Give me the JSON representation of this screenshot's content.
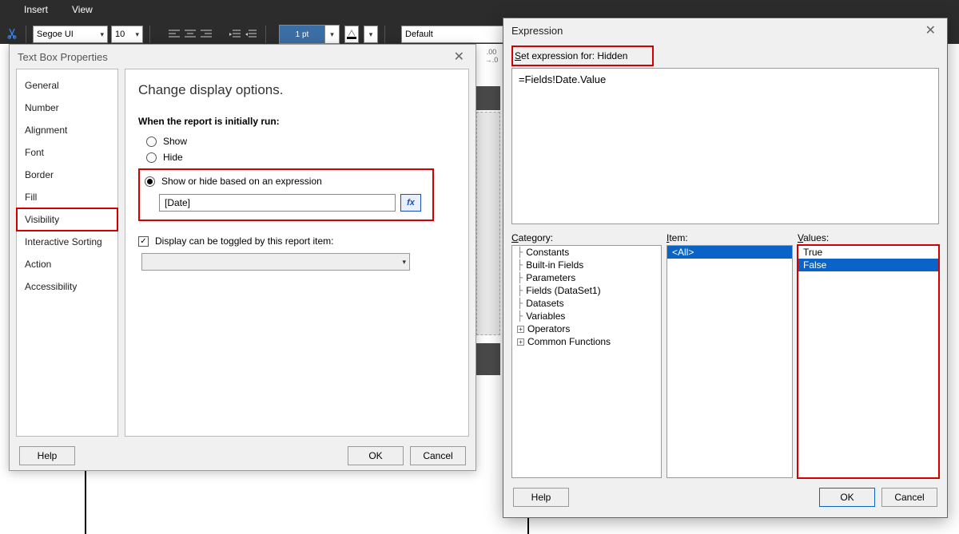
{
  "ribbon": {
    "tabs": [
      "Insert",
      "View"
    ],
    "font_name": "Segoe UI",
    "font_size": "10",
    "border_width": "1 pt",
    "style": "Default"
  },
  "dlg1": {
    "title": "Text Box Properties",
    "nav": {
      "items": [
        "General",
        "Number",
        "Alignment",
        "Font",
        "Border",
        "Fill",
        "Visibility",
        "Interactive Sorting",
        "Action",
        "Accessibility"
      ],
      "selected": "Visibility"
    },
    "heading": "Change display options.",
    "group_label": "When the report is initially run:",
    "radios": {
      "show": "Show",
      "hide": "Hide",
      "expression": "Show or hide based on an expression"
    },
    "expr_value": "[Date]",
    "fx_label": "fx",
    "chk_label": "Display can be toggled by this report item:",
    "help": "Help",
    "ok": "OK",
    "cancel": "Cancel"
  },
  "dlg2": {
    "title": "Expression",
    "setexpr_prefix": "S",
    "setexpr_rest": "et expression for: Hidden",
    "expr_text": "=Fields!Date.Value",
    "labels": {
      "category": "Category:",
      "item": "Item:",
      "values": "Values:"
    },
    "category": [
      "Constants",
      "Built-in Fields",
      "Parameters",
      "Fields (DataSet1)",
      "Datasets",
      "Variables",
      "Operators",
      "Common Functions"
    ],
    "item_list": [
      "<All>"
    ],
    "item_selected": "<All>",
    "values_list": [
      "True",
      "False"
    ],
    "values_selected": "False",
    "help": "Help",
    "ok": "OK",
    "cancel": "Cancel"
  }
}
